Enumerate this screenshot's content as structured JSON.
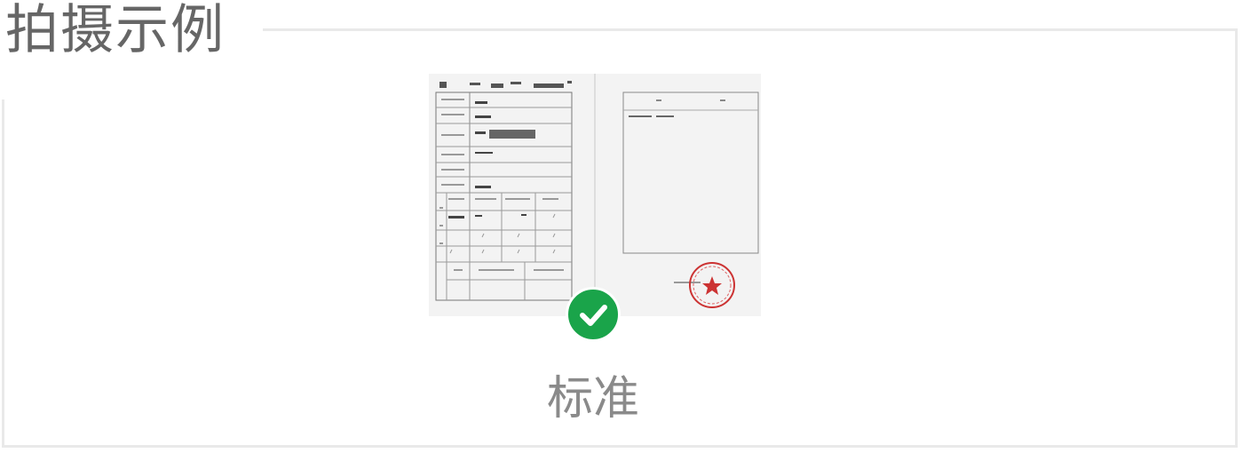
{
  "section": {
    "title": "拍摄示例"
  },
  "example": {
    "caption": "标准",
    "status_icon": "check-circle-icon",
    "status_color": "#1aa44a",
    "document": {
      "header_number": "2002773",
      "seal_color": "#cc3333"
    }
  }
}
